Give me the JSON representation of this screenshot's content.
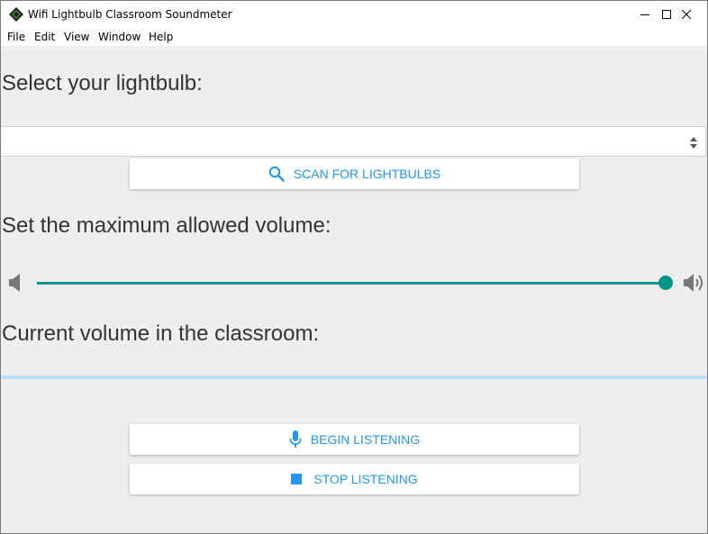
{
  "window": {
    "title": "Wifi Lightbulb Classroom Soundmeter",
    "minimize_icon": "minimize-icon",
    "maximize_icon": "maximize-icon",
    "close_icon": "close-icon"
  },
  "menu": [
    "File",
    "Edit",
    "View",
    "Window",
    "Help"
  ],
  "lightbulb": {
    "heading": "Select your lightbulb:",
    "selected_value": "",
    "scan_label": "SCAN FOR LIGHTBULBS",
    "scan_icon": "search-icon"
  },
  "volume": {
    "heading": "Set the maximum allowed volume:",
    "slider_value_fraction": 1.0,
    "min_icon": "volume-low-icon",
    "max_icon": "volume-high-icon"
  },
  "current": {
    "heading": "Current volume in the classroom:",
    "level_fraction": 0
  },
  "controls": {
    "begin_label": "BEGIN LISTENING",
    "begin_icon": "microphone-icon",
    "stop_label": "STOP LISTENING",
    "stop_icon": "stop-icon"
  },
  "colors": {
    "accent_blue": "#2196f3",
    "slider_teal": "#009688",
    "progress_track": "#bbdefb"
  }
}
